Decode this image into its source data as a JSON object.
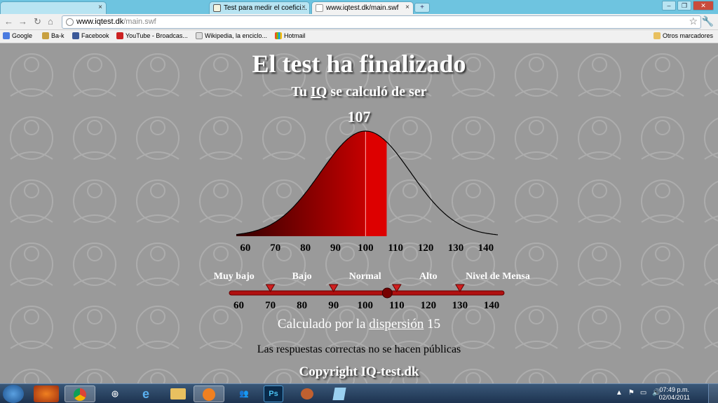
{
  "browser": {
    "tabs": [
      {
        "label": "",
        "active": false
      },
      {
        "label": "Test para medir el coefici...",
        "active": false
      },
      {
        "label": "www.iqtest.dk/main.swf",
        "active": true
      }
    ],
    "url_host": "www.iqtest.dk",
    "url_path": "/main.swf",
    "bookmarks": [
      "Google",
      "Ba-k",
      "Facebook",
      "YouTube - Broadcas...",
      "Wikipedia, la enciclo...",
      "Hotmail"
    ],
    "other_bookmarks": "Otros marcadores"
  },
  "page": {
    "title": "El test ha finalizado",
    "subtitle_prefix": "Tu ",
    "subtitle_link": "IQ",
    "subtitle_suffix": " se calculó de ser",
    "score": "107",
    "dispersion_prefix": "Calculado por la ",
    "dispersion_link": "dispersión",
    "dispersion_value": " 15",
    "note": "Las respuestas correctas no se hacen públicas",
    "copyright": "Copyright IQ-test.dk"
  },
  "chart_data": {
    "type": "area",
    "title": "",
    "x_ticks": [
      "60",
      "70",
      "80",
      "90",
      "100",
      "110",
      "120",
      "130",
      "140"
    ],
    "xlim": [
      57,
      144
    ],
    "mean": 100,
    "sd": 15,
    "highlight_to": 107,
    "colors": {
      "fill": "#dd0000",
      "dark": "#330000",
      "line": "#000000"
    },
    "scale": {
      "categories": [
        "Muy bajo",
        "Bajo",
        "Normal",
        "Alto",
        "Nivel de Mensa"
      ],
      "thresholds": [
        70,
        90,
        110,
        130
      ],
      "marker": 107,
      "ticks": [
        "60",
        "70",
        "80",
        "90",
        "100",
        "110",
        "120",
        "130",
        "140"
      ]
    }
  },
  "taskbar": {
    "time": "07:49 p.m.",
    "date": "02/04/2011",
    "apps": [
      "firefox",
      "chrome",
      "safari",
      "ie",
      "explorer",
      "media-player",
      "messenger",
      "Ps",
      "gimp",
      "files"
    ]
  }
}
